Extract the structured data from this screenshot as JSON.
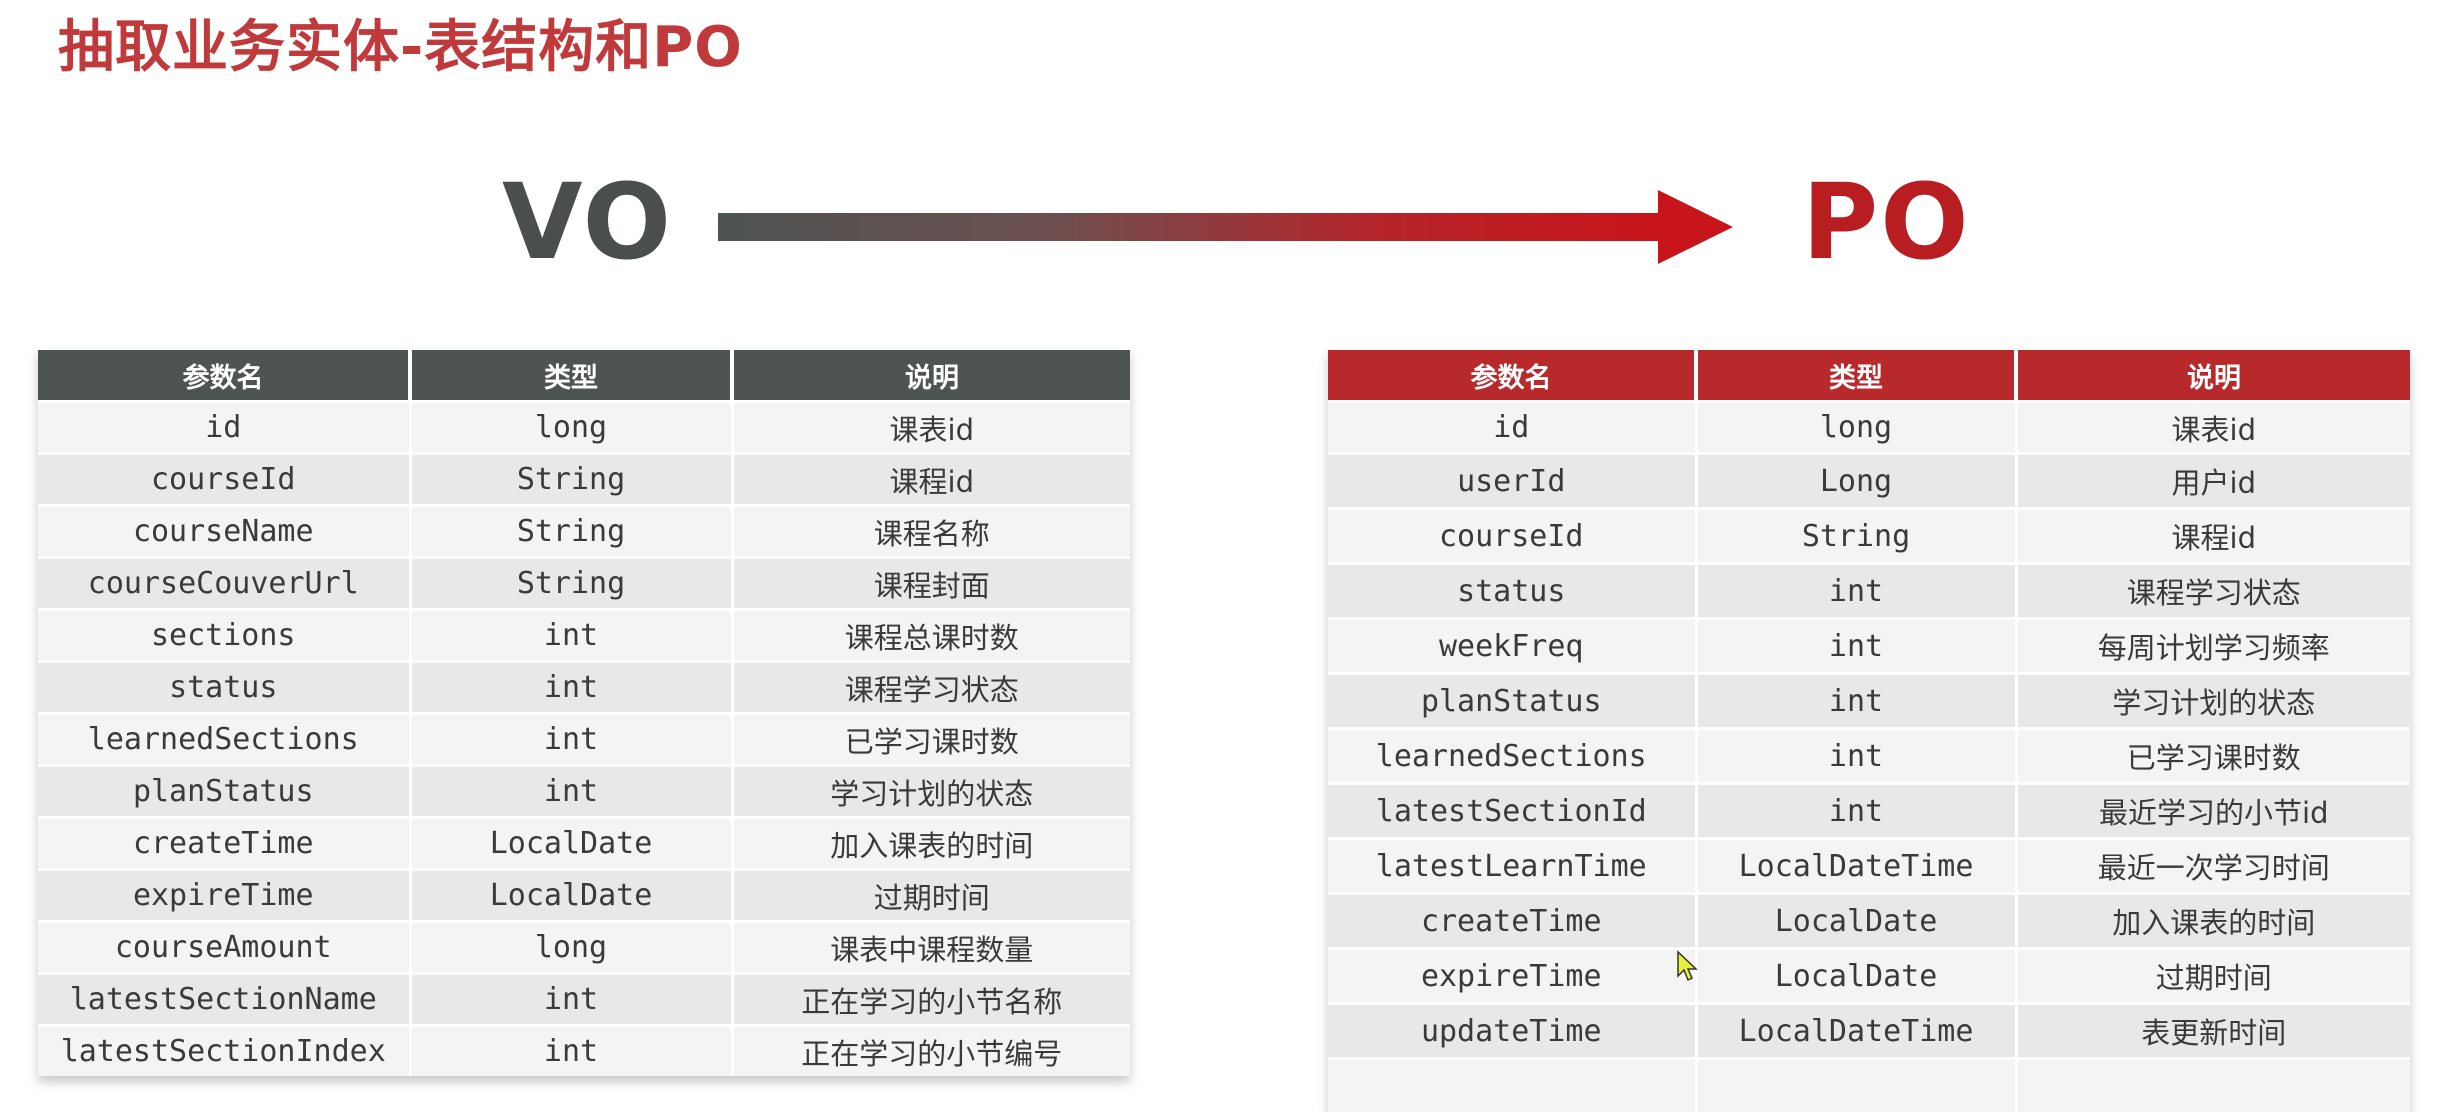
{
  "slide_title": "抽取业务实体-表结构和PO",
  "vo_label": "VO",
  "po_label": "PO",
  "colors": {
    "title": "#c0393b",
    "vo_header": "#4d5452",
    "po_header": "#b8292c"
  },
  "vo_table": {
    "headers": [
      "参数名",
      "类型",
      "说明"
    ],
    "rows": [
      [
        "id",
        "long",
        "课表id"
      ],
      [
        "courseId",
        "String",
        "课程id"
      ],
      [
        "courseName",
        "String",
        "课程名称"
      ],
      [
        "courseCouverUrl",
        "String",
        "课程封面"
      ],
      [
        "sections",
        "int",
        "课程总课时数"
      ],
      [
        "status",
        "int",
        "课程学习状态"
      ],
      [
        "learnedSections",
        "int",
        "已学习课时数"
      ],
      [
        "planStatus",
        "int",
        "学习计划的状态"
      ],
      [
        "createTime",
        "LocalDate",
        "加入课表的时间"
      ],
      [
        "expireTime",
        "LocalDate",
        "过期时间"
      ],
      [
        "courseAmount",
        "long",
        "课表中课程数量"
      ],
      [
        "latestSectionName",
        "int",
        "正在学习的小节名称"
      ],
      [
        "latestSectionIndex",
        "int",
        "正在学习的小节编号"
      ]
    ]
  },
  "po_table": {
    "headers": [
      "参数名",
      "类型",
      "说明"
    ],
    "rows": [
      [
        "id",
        "long",
        "课表id"
      ],
      [
        "userId",
        "Long",
        "用户id"
      ],
      [
        "courseId",
        "String",
        "课程id"
      ],
      [
        "status",
        "int",
        "课程学习状态"
      ],
      [
        "weekFreq",
        "int",
        "每周计划学习频率"
      ],
      [
        "planStatus",
        "int",
        "学习计划的状态"
      ],
      [
        "learnedSections",
        "int",
        "已学习课时数"
      ],
      [
        "latestSectionId",
        "int",
        "最近学习的小节id"
      ],
      [
        "latestLearnTime",
        "LocalDateTime",
        "最近一次学习时间"
      ],
      [
        "createTime",
        "LocalDate",
        "加入课表的时间"
      ],
      [
        "expireTime",
        "LocalDate",
        "过期时间"
      ],
      [
        "updateTime",
        "LocalDateTime",
        "表更新时间"
      ],
      [
        "",
        "",
        ""
      ]
    ]
  }
}
